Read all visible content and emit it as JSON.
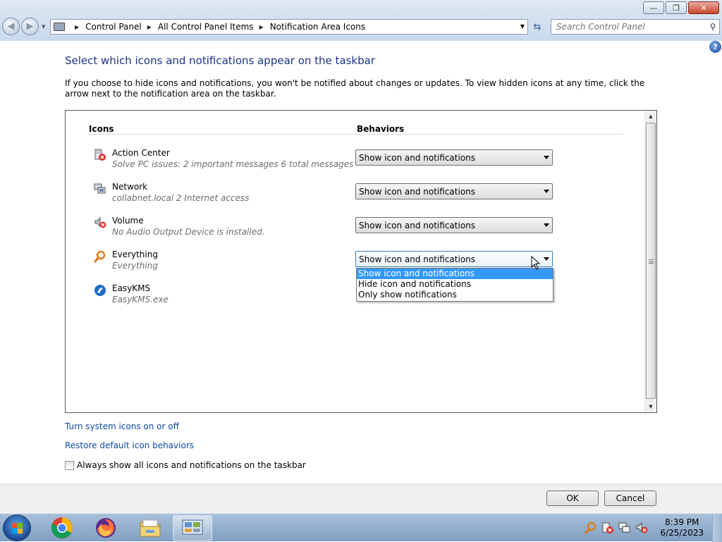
{
  "window": {
    "minimize_glyph": "—",
    "maximize_glyph": "❐",
    "close_glyph": "✕"
  },
  "address": {
    "crumbs": [
      "Control Panel",
      "All Control Panel Items",
      "Notification Area Icons"
    ]
  },
  "search": {
    "placeholder": "Search Control Panel"
  },
  "page": {
    "title": "Select which icons and notifications appear on the taskbar",
    "description": "If you choose to hide icons and notifications, you won't be notified about changes or updates. To view hidden icons at any time, click the arrow next to the notification area on the taskbar."
  },
  "table": {
    "col_icons": "Icons",
    "col_behaviors": "Behaviors",
    "rows": [
      {
        "name": "Action Center",
        "detail": "Solve PC issues: 2 important messages  6 total messages",
        "behavior": "Show icon and notifications",
        "icon": "action-center-icon"
      },
      {
        "name": "Network",
        "detail": "collabnet.local  2 Internet access",
        "behavior": "Show icon and notifications",
        "icon": "network-icon"
      },
      {
        "name": "Volume",
        "detail": "No Audio Output Device is installed.",
        "behavior": "Show icon and notifications",
        "icon": "volume-muted-icon"
      },
      {
        "name": "Everything",
        "detail": "Everything",
        "behavior": "Show icon and notifications",
        "icon": "everything-search-icon"
      },
      {
        "name": "EasyKMS",
        "detail": "EasyKMS.exe",
        "behavior": "",
        "icon": "easykms-icon"
      }
    ]
  },
  "dropdown": {
    "options": [
      "Show icon and notifications",
      "Hide icon and notifications",
      "Only show notifications"
    ],
    "selected_index": 0
  },
  "links": {
    "system_icons": "Turn system icons on or off",
    "restore_defaults": "Restore default icon behaviors"
  },
  "checkbox": {
    "label": "Always show all icons and notifications on the taskbar",
    "checked": false
  },
  "buttons": {
    "ok": "OK",
    "cancel": "Cancel"
  },
  "taskbar": {
    "apps": [
      "chrome-icon",
      "firefox-icon",
      "file-explorer-icon",
      "control-panel-icon"
    ],
    "active_app": "control-panel-icon"
  },
  "clock": {
    "time": "8:39 PM",
    "date": "6/25/2023"
  },
  "colors": {
    "title_blue": "#1e3287",
    "link_blue": "#0d4aa8",
    "selection": "#3399ff"
  }
}
